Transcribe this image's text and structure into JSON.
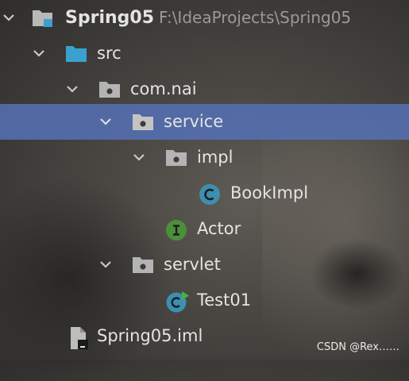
{
  "project": {
    "name": "Spring05",
    "path": "F:\\IdeaProjects\\Spring05"
  },
  "tree": {
    "src": "src",
    "package_root": "com.nai",
    "service": "service",
    "impl": "impl",
    "book_impl": "BookImpl",
    "actor": "Actor",
    "servlet": "servlet",
    "test01": "Test01",
    "iml_file": "Spring05.iml"
  },
  "icons": {
    "module": "module-folder-icon",
    "source_folder": "source-folder-icon",
    "package": "package-icon",
    "class": "class-icon",
    "interface": "interface-icon",
    "runnable_class": "runnable-class-icon",
    "iml": "iml-file-icon"
  },
  "colors": {
    "selection": "#5470b2",
    "class_icon": "#3d8fb0",
    "interface_icon": "#4c8f3a",
    "folder_blue": "#3aa0cf",
    "package_grey": "#b4b4b4"
  },
  "watermark": "CSDN @Rex……"
}
